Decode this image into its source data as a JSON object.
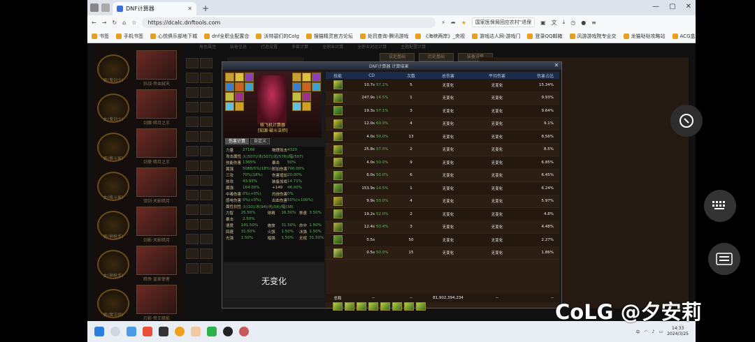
{
  "browser": {
    "tab_title": "DNF计算器",
    "url": "https://dcalc.dnftools.com",
    "ext_banner": "国家医保局回应农村\"退保",
    "bookmarks": [
      "书签",
      "手机书签",
      "心悦俱乐部地下城",
      "dnf全职业配置合",
      "沃特碧们的Colg",
      "搜猫精灵官方论坛",
      "处罚查询-腾讯游戏",
      "《海峡两岸》_央视",
      "游戏达人网-游戏门",
      "登录QQ邮箱",
      "风游游戏院专业交",
      "龙猫哒哒攻略站",
      "ACG盒动漫 - 萌次"
    ]
  },
  "page": {
    "top_nav": [
      "角色属性",
      "装备信息",
      "打造设置",
      "多套计算",
      "全职业计算",
      "全职业对比计算",
      "主题配置计算"
    ],
    "top_tabs": [
      "设定基础",
      "历史基础",
      "装备详情"
    ],
    "left_characters": [
      {
        "label": "男(鬼剑士)",
        "portrait": "狂战·帝血弑天"
      },
      {
        "label": "女(鬼剑士)",
        "portrait": "剑魔·暗月之王"
      },
      {
        "label": "男(格斗家)",
        "portrait": "剑豪·暗月之王"
      },
      {
        "label": "女(格斗家)",
        "portrait": "驭剑·天影暗月"
      },
      {
        "label": "男(神枪手)",
        "portrait": "剑影·天影暗月"
      },
      {
        "label": "女(神枪手)",
        "portrait": "暗帝·皇家使者"
      },
      {
        "label": "男(魔法师)",
        "portrait": "刃影·帝王暗影"
      }
    ]
  },
  "dialog": {
    "title": "DNF计算器 计算结果",
    "character_name": "核飞机计算器",
    "character_class": "[知源·破斗法师]",
    "sub_tabs": [
      "伤害计算",
      "自定义"
    ],
    "stats": [
      {
        "text": "力量",
        "value": "27166",
        "extra": "物理攻击",
        "extra_value": "4320"
      },
      {
        "text": "攻击属性",
        "value": "火(507)/冰(507)/光(576)/暗(507)"
      },
      {
        "text": "技能伤害",
        "value": "1365%",
        "extra": "暴击",
        "extra_value": "50%"
      },
      {
        "text": "属强",
        "value": "5086/5%(18%)",
        "extra": "附加伤害",
        "extra_value": "700.00%"
      },
      {
        "text": "三攻",
        "value": "70%(18%)",
        "extra": "伤害增加",
        "extra_value": "20.00%"
      },
      {
        "text": "技攻",
        "value": "43.93%",
        "extra": "装备加成",
        "extra_value": "14.71%"
      },
      {
        "text": "属强",
        "value": "164.00%",
        "extra": "+149",
        "extra_value": "46.00%"
      },
      {
        "text": "中毒伤害",
        "value": "0%(+0%)",
        "extra": "灼烧伤害",
        "extra_value": "0%"
      },
      {
        "text": "感电伤害",
        "value": "0%(+0%)",
        "extra": "出血伤害",
        "extra_value": "50%(+100%)"
      },
      {
        "text": "属性抗性",
        "value": "火(10)/冰(94)/光(56)/暗(38)"
      },
      {
        "text": "力智",
        "value": "25.50%",
        "extra": "体精",
        "extra_value": "16.50%",
        "extra2": "移速",
        "extra2_value": "3.50%"
      },
      {
        "text": "暴击",
        "value": "2.50%"
      },
      {
        "text": "速度",
        "value": "141.50%",
        "extra": "施放",
        "extra_value": "31.50%",
        "extra2": "命中",
        "extra2_value": "1.50%"
      },
      {
        "text": "回避",
        "value": "31.50%",
        "extra": "火强",
        "extra_value": "1.50%",
        "extra2": "冰强",
        "extra2_value": "1.50%"
      },
      {
        "text": "光强",
        "value": "1.50%",
        "extra": "暗强",
        "extra_value": "1.50%",
        "extra2": "无视",
        "extra2_value": "31.50%"
      }
    ],
    "result_text": "无变化",
    "table": {
      "headers": [
        "技能",
        "CD",
        "次数",
        "总伤害",
        "平均伤害",
        "伤害占比"
      ],
      "rows": [
        {
          "cd": "10.7s",
          "cd_pct": "57.1%",
          "count": "5",
          "total": "无变化",
          "avg": "无变化",
          "ratio": "15.34%"
        },
        {
          "cd": "247.9s",
          "cd_pct": "14.5%",
          "count": "1",
          "total": "无变化",
          "avg": "无变化",
          "ratio": "9.93%"
        },
        {
          "cd": "19.3s",
          "cd_pct": "57.1%",
          "count": "3",
          "total": "无变化",
          "avg": "无变化",
          "ratio": "9.64%"
        },
        {
          "cd": "12.0s",
          "cd_pct": "60.0%",
          "count": "4",
          "total": "无变化",
          "avg": "无变化",
          "ratio": "9.1%"
        },
        {
          "cd": "4.0s",
          "cd_pct": "50.0%",
          "count": "13",
          "total": "无变化",
          "avg": "无变化",
          "ratio": "8.56%"
        },
        {
          "cd": "25.8s",
          "cd_pct": "57.0%",
          "count": "2",
          "total": "无变化",
          "avg": "无变化",
          "ratio": "8.5%"
        },
        {
          "cd": "4.0s",
          "cd_pct": "50.0%",
          "count": "9",
          "total": "无变化",
          "avg": "无变化",
          "ratio": "6.85%"
        },
        {
          "cd": "6.0s",
          "cd_pct": "50.0%",
          "count": "6",
          "total": "无变化",
          "avg": "无变化",
          "ratio": "6.45%"
        },
        {
          "cd": "153.9s",
          "cd_pct": "14.5%",
          "count": "1",
          "total": "无变化",
          "avg": "无变化",
          "ratio": "6.24%"
        },
        {
          "cd": "9.9s",
          "cd_pct": "50.0%",
          "count": "4",
          "total": "无变化",
          "avg": "无变化",
          "ratio": "5.97%"
        },
        {
          "cd": "19.2s",
          "cd_pct": "52.0%",
          "count": "2",
          "total": "无变化",
          "avg": "无变化",
          "ratio": "4.8%"
        },
        {
          "cd": "12.4s",
          "cd_pct": "50.4%",
          "count": "3",
          "total": "无变化",
          "avg": "无变化",
          "ratio": "4.48%"
        },
        {
          "cd": "0.5s",
          "cd_pct": "",
          "count": "50",
          "total": "无变化",
          "avg": "无变化",
          "ratio": "2.27%"
        },
        {
          "cd": "0.5s",
          "cd_pct": "50.0%",
          "count": "15",
          "total": "无变化",
          "avg": "无变化",
          "ratio": "1.86%"
        }
      ],
      "total_label": "总和",
      "total_cd": "--",
      "total_count": "--",
      "total_damage": "81,902,394,234",
      "total_avg": "--",
      "total_ratio": "--"
    }
  },
  "taskbar": {
    "time": "14:33",
    "date": "2024/3/25"
  },
  "watermark": "CoLG @夕安莉"
}
